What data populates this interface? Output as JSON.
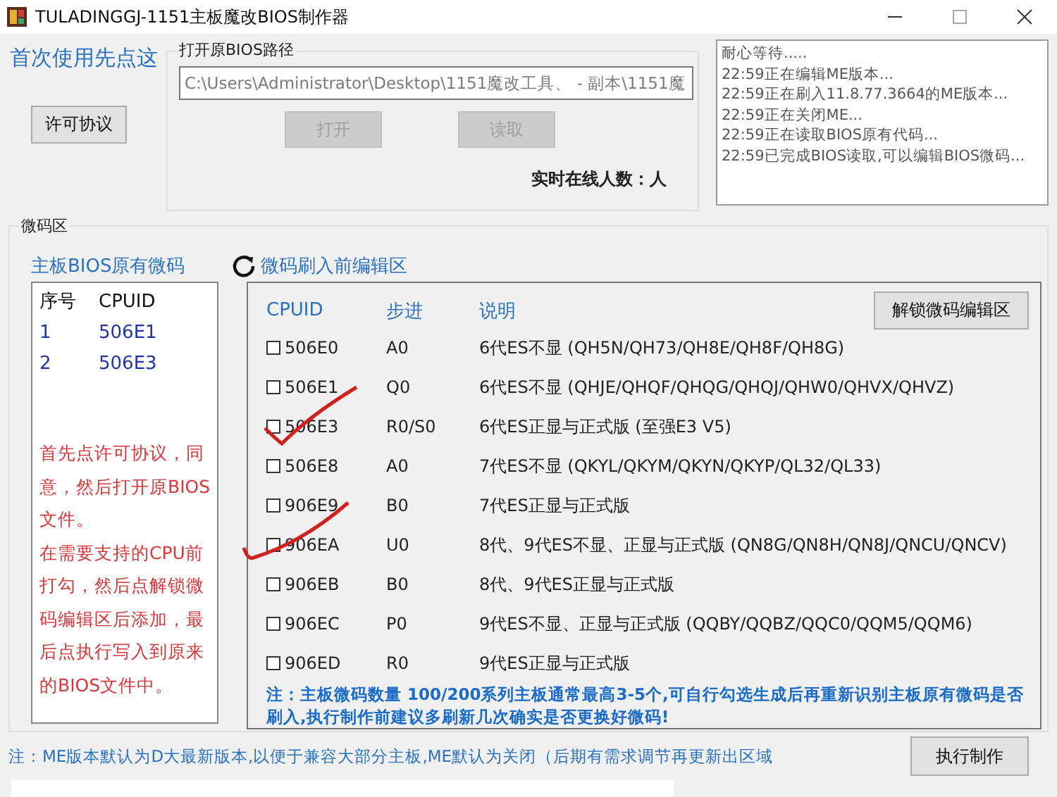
{
  "window": {
    "title": "TULADINGGJ-1151主板魔改BIOS制作器"
  },
  "first_use_link": "首次使用先点这",
  "license_button": "许可协议",
  "bios_path": {
    "legend": "打开原BIOS路径",
    "value": "C:\\Users\\Administrator\\Desktop\\1151魔改工具、 - 副本\\1151魔",
    "buttons": [
      {
        "label": "打开",
        "disabled": true
      },
      {
        "label": "读取",
        "disabled": true
      }
    ],
    "online_label": "实时在线人数：人"
  },
  "log": [
    "耐心等待.....",
    "22:59正在编辑ME版本...",
    "22:59正在刷入11.8.77.3664的ME版本...",
    "22:59正在关闭ME...",
    "22:59正在读取BIOS原有代码...",
    "22:59已完成BIOS读取,可以编辑BIOS微码..."
  ],
  "microcode": {
    "legend": "微码区",
    "original": {
      "title": "主板BIOS原有微码",
      "columns": [
        "序号",
        "CPUID"
      ],
      "rows": [
        {
          "index": "1",
          "cpuid": "506E1"
        },
        {
          "index": "2",
          "cpuid": "506E3"
        }
      ],
      "instructions": [
        "首先点许可协议，同意，然后打开原BIOS文件。",
        "在需要支持的CPU前打勾，然后点解锁微码编辑区后添加，最后点执行写入到原来的BIOS文件中。"
      ]
    },
    "editor": {
      "title": "微码刷入前编辑区",
      "columns": [
        "CPUID",
        "步进",
        "说明"
      ],
      "unlock_button": "解锁微码编辑区",
      "rows": [
        {
          "cpuid": "506E0",
          "checked": false,
          "stepping": "A0",
          "description": "6代ES不显 (QH5N/QH73/QH8E/QH8F/QH8G)"
        },
        {
          "cpuid": "506E1",
          "checked": false,
          "stepping": "Q0",
          "description": "6代ES不显 (QHJE/QHQF/QHQG/QHQJ/QHW0/QHVX/QHVZ)"
        },
        {
          "cpuid": "506E3",
          "checked": false,
          "stepping": "R0/S0",
          "description": "6代ES正显与正式版 (至强E3 V5)"
        },
        {
          "cpuid": "506E8",
          "checked": false,
          "stepping": "A0",
          "description": "7代ES不显 (QKYL/QKYM/QKYN/QKYP/QL32/QL33)"
        },
        {
          "cpuid": "906E9",
          "checked": false,
          "stepping": "B0",
          "description": "7代ES正显与正式版"
        },
        {
          "cpuid": "906EA",
          "checked": false,
          "stepping": "U0",
          "description": "8代、9代ES不显、正显与正式版 (QN8G/QN8H/QN8J/QNCU/QNCV)"
        },
        {
          "cpuid": "906EB",
          "checked": false,
          "stepping": "B0",
          "description": "8代、9代ES正显与正式版"
        },
        {
          "cpuid": "906EC",
          "checked": false,
          "stepping": "P0",
          "description": "9代ES不显、正显与正式版 (QQBY/QQBZ/QQC0/QQM5/QQM6)"
        },
        {
          "cpuid": "906ED",
          "checked": false,
          "stepping": "R0",
          "description": "9代ES正显与正式版"
        }
      ],
      "note": "注：主板微码数量 100/200系列主板通常最高3-5个,可自行勾选生成后再重新识别主板原有微码是否刷入,执行制作前建议多刷新几次确实是否更换好微码!"
    }
  },
  "bottom_note": "注：ME版本默认为D大最新版本,以便于兼容大部分主板,ME默认为关闭（后期有需求调节再更新出区域",
  "execute_button": "执行制作"
}
